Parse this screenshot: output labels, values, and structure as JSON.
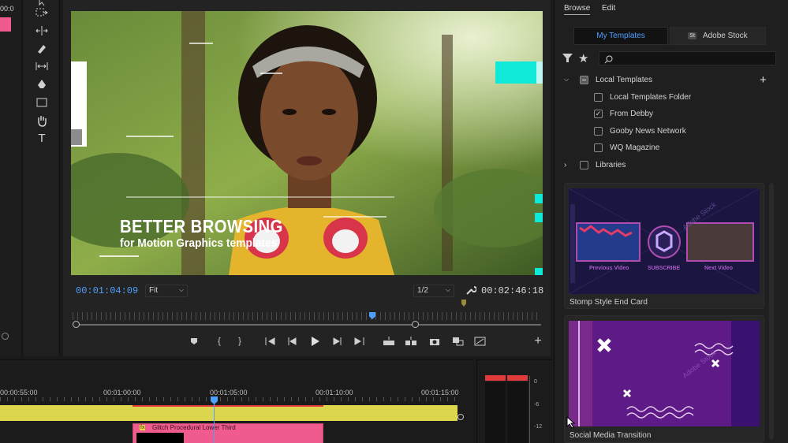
{
  "left_strip": {
    "label": "00:0"
  },
  "monitor": {
    "overlay_title": "BETTER BROWSING",
    "overlay_subtitle": "for Motion Graphics templates",
    "timecode_current": "00:01:04:09",
    "zoom": "Fit",
    "resolution": "1/2",
    "timecode_duration": "00:02:46:18"
  },
  "panel": {
    "tabs": [
      "Browse",
      "Edit"
    ],
    "segments": [
      "My Templates",
      "Adobe Stock"
    ],
    "stock_badge": "St",
    "search_placeholder": "",
    "tree": {
      "local_templates": "Local Templates",
      "children": [
        {
          "label": "Local Templates Folder",
          "checked": false
        },
        {
          "label": "From Debby",
          "checked": true
        },
        {
          "label": "Gooby News Network",
          "checked": false
        },
        {
          "label": "WQ Magazine",
          "checked": false
        }
      ],
      "libraries": "Libraries"
    },
    "cards": [
      {
        "name": "Stomp Style End Card",
        "thumb_labels": [
          "Previous Video",
          "SUBSCRIBE",
          "Next Video"
        ],
        "watermark": "Adobe Stock"
      },
      {
        "name": "Social Media Transition",
        "watermark": "Adobe Stock"
      }
    ]
  },
  "timeline": {
    "ruler": [
      "00:00:55:00",
      "00:01:00:00",
      "00:01:05:00",
      "00:01:10:00",
      "00:01:15:00"
    ],
    "clip_label": "Glitch Procedural Lower Third",
    "clip_badge": "fx"
  },
  "meter": {
    "scale": [
      "0",
      "-6",
      "-12"
    ]
  },
  "colors": {
    "accent_blue": "#4f9fff",
    "clip_pink": "#ef5b8f",
    "track_yellow": "#dcd54e",
    "meter_red": "#e03a3a"
  }
}
